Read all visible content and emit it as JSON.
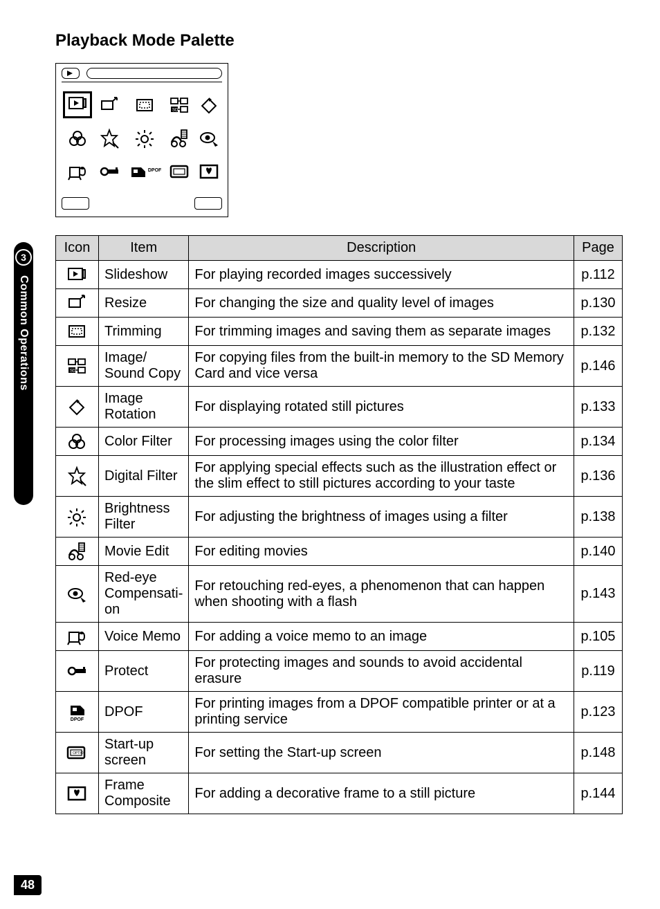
{
  "sideTab": {
    "chapterNum": "3",
    "chapterLabel": "Common Operations"
  },
  "pageNumber": "48",
  "title": "Playback Mode Palette",
  "tableHeaders": {
    "icon": "Icon",
    "item": "Item",
    "description": "Description",
    "page": "Page"
  },
  "rows": [
    {
      "iconName": "slideshow-icon",
      "item": "Slideshow",
      "desc": "For playing recorded images successively",
      "page": "p.112"
    },
    {
      "iconName": "resize-icon",
      "item": "Resize",
      "desc": "For changing the size and quality level of images",
      "page": "p.130"
    },
    {
      "iconName": "trimming-icon",
      "item": "Trimming",
      "desc": "For trimming images and saving them as separate images",
      "page": "p.132"
    },
    {
      "iconName": "image-sound-copy-icon",
      "item": "Image/\nSound Copy",
      "desc": "For copying files from the built-in memory to the SD Memory Card and vice versa",
      "page": "p.146"
    },
    {
      "iconName": "image-rotation-icon",
      "item": "Image Rotation",
      "desc": "For displaying rotated still pictures",
      "page": "p.133"
    },
    {
      "iconName": "color-filter-icon",
      "item": "Color Filter",
      "desc": "For processing images using the color filter",
      "page": "p.134"
    },
    {
      "iconName": "digital-filter-icon",
      "item": "Digital Filter",
      "desc": "For applying special effects such as the illustration effect or the slim effect to still pictures according to your taste",
      "page": "p.136"
    },
    {
      "iconName": "brightness-filter-icon",
      "item": "Brightness Filter",
      "desc": "For adjusting the brightness of images using a filter",
      "page": "p.138"
    },
    {
      "iconName": "movie-edit-icon",
      "item": "Movie Edit",
      "desc": "For editing movies",
      "page": "p.140"
    },
    {
      "iconName": "red-eye-icon",
      "item": "Red-eye Compensati-on",
      "desc": "For retouching red-eyes, a phenomenon that can happen when shooting with a flash",
      "page": "p.143"
    },
    {
      "iconName": "voice-memo-icon",
      "item": "Voice Memo",
      "desc": "For adding a voice memo to an image",
      "page": "p.105"
    },
    {
      "iconName": "protect-icon",
      "item": "Protect",
      "desc": "For protecting images and sounds to avoid accidental erasure",
      "page": "p.119"
    },
    {
      "iconName": "dpof-icon",
      "item": "DPOF",
      "desc": "For printing images from a DPOF compatible printer or at a printing service",
      "page": "p.123"
    },
    {
      "iconName": "startup-screen-icon",
      "item": "Start-up screen",
      "desc": "For setting the Start-up screen",
      "page": "p.148"
    },
    {
      "iconName": "frame-composite-icon",
      "item": "Frame Composite",
      "desc": "For adding a decorative frame to a still picture",
      "page": "p.144"
    }
  ],
  "dpofLabel": "DPOF",
  "optioLabel": "OPTIO"
}
